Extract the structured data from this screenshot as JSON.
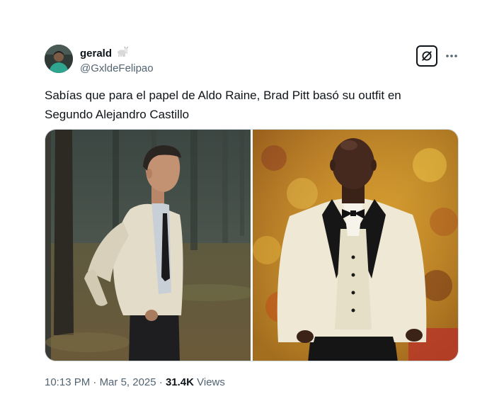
{
  "author": {
    "display_name": "gerald",
    "badge_icon": "goat-emoji-icon",
    "handle": "@GxldeFelipao"
  },
  "header_actions": {
    "grok_icon": "grok-icon",
    "more_icon": "more-options-icon"
  },
  "tweet": {
    "text_line_1": "Sabías que para el papel de Aldo Raine, Brad Pitt basó su outfit en",
    "text_line_2": "Segundo Alejandro Castillo"
  },
  "media": {
    "count": 2
  },
  "meta": {
    "time": "10:13 PM",
    "separator_1": " · ",
    "date": "Mar 5, 2025",
    "separator_2": " · ",
    "views_count": "31.4K",
    "views_label": " Views"
  },
  "colors": {
    "text_primary": "#0f1419",
    "text_secondary": "#536471",
    "border": "#cfd9de"
  }
}
